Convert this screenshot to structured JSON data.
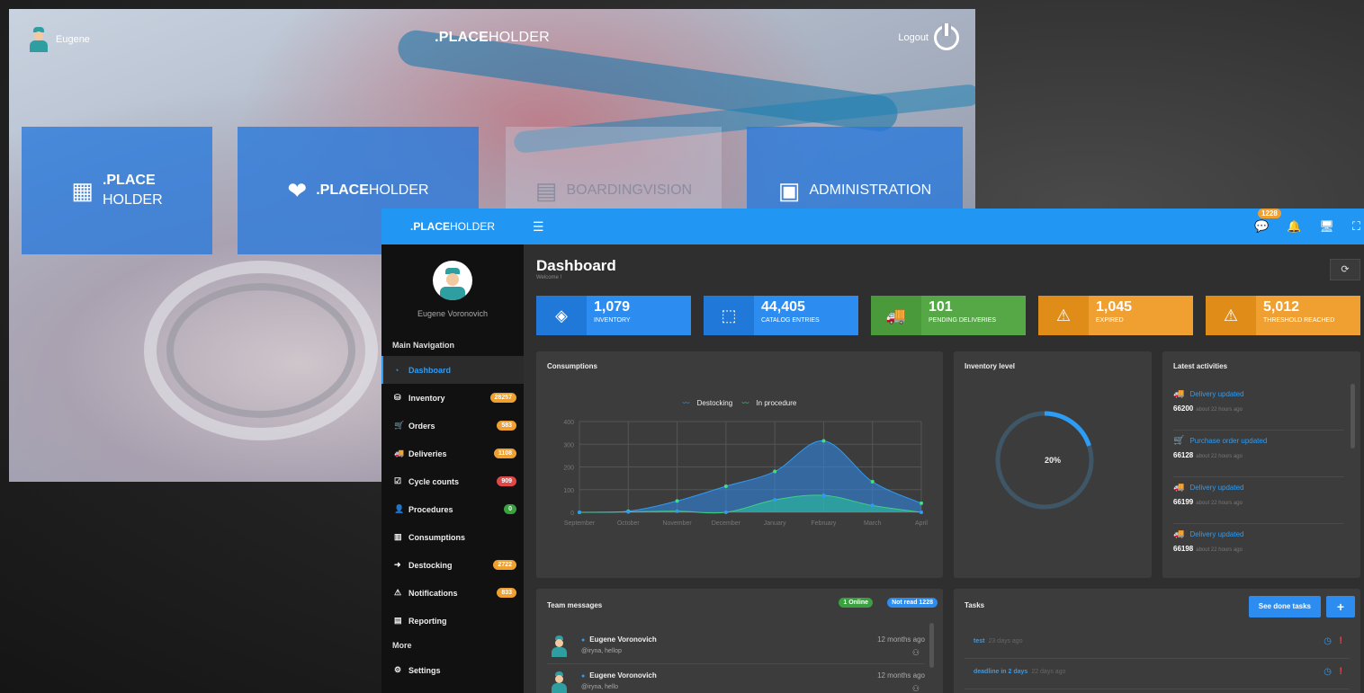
{
  "launcher": {
    "user_name": "Eugene",
    "title_bold": ".PLACE",
    "title_rest": "HOLDER",
    "logout_label": "Logout",
    "tiles": [
      {
        "bold": ".PLACE",
        "rest": "HOLDER",
        "icon": "warehouse-icon"
      },
      {
        "bold": ".PLACE",
        "rest": "HOLDER",
        "icon": "heart-icon"
      },
      {
        "bold": "",
        "rest": "BOARDINGVISION",
        "icon": "board-icon"
      },
      {
        "bold": "",
        "rest": "ADMINISTRATION",
        "icon": "admin-icon"
      }
    ]
  },
  "topbar": {
    "brand_bold": ".PLACE",
    "brand_rest": "HOLDER",
    "notification_count": "1228"
  },
  "sidebar": {
    "profile_name": "Eugene Voronovich",
    "main_label": "Main Navigation",
    "items": [
      {
        "label": "Dashboard",
        "icon": "dashboard-icon",
        "badge": "",
        "color": ""
      },
      {
        "label": "Inventory",
        "icon": "database-icon",
        "badge": "28257",
        "color": "orange"
      },
      {
        "label": "Orders",
        "icon": "cart-icon",
        "badge": "583",
        "color": "orange"
      },
      {
        "label": "Deliveries",
        "icon": "truck-icon",
        "badge": "1108",
        "color": "orange"
      },
      {
        "label": "Cycle counts",
        "icon": "checkbox-icon",
        "badge": "909",
        "color": "red"
      },
      {
        "label": "Procedures",
        "icon": "user-icon",
        "badge": "0",
        "color": "green"
      },
      {
        "label": "Consumptions",
        "icon": "bar-chart-icon",
        "badge": "",
        "color": ""
      },
      {
        "label": "Destocking",
        "icon": "sign-out-icon",
        "badge": "2722",
        "color": "orange"
      },
      {
        "label": "Notifications",
        "icon": "warning-icon",
        "badge": "833",
        "color": "orange"
      },
      {
        "label": "Reporting",
        "icon": "file-icon",
        "badge": "",
        "color": ""
      }
    ],
    "more_label": "More",
    "settings_label": "Settings"
  },
  "dashboard": {
    "title": "Dashboard",
    "subtitle": "Welcome !",
    "stats": [
      {
        "value": "1,079",
        "label": "INVENTORY",
        "icon": "layers-icon",
        "color": "blue"
      },
      {
        "value": "44,405",
        "label": "CATALOG ENTRIES",
        "icon": "box-icon",
        "color": "blue"
      },
      {
        "value": "101",
        "label": "PENDING DELIVERIES",
        "icon": "truck-icon",
        "color": "green"
      },
      {
        "value": "1,045",
        "label": "EXPIRED",
        "icon": "warning-icon",
        "color": "orange"
      },
      {
        "value": "5,012",
        "label": "THRESHOLD REACHED",
        "icon": "warning-icon",
        "color": "orange"
      }
    ]
  },
  "consumptions": {
    "title": "Consumptions"
  },
  "chart_data": {
    "type": "area",
    "title": "Consumptions",
    "categories": [
      "September",
      "October",
      "November",
      "December",
      "January",
      "February",
      "March",
      "April"
    ],
    "series": [
      {
        "name": "Destocking",
        "color": "#2d9cf5",
        "values": [
          0,
          5,
          50,
          115,
          180,
          315,
          135,
          40
        ]
      },
      {
        "name": "In procedure",
        "color": "#40d080",
        "values": [
          0,
          2,
          5,
          0,
          55,
          75,
          30,
          0
        ]
      }
    ],
    "yticks": [
      "400",
      "300",
      "200",
      "100",
      "0"
    ],
    "ylim": [
      0,
      400
    ],
    "grid": true,
    "legend": "top"
  },
  "inventory_level": {
    "title": "Inventory level",
    "percent": 20,
    "label": "20%"
  },
  "activities": {
    "title": "Latest activities",
    "items": [
      {
        "action": "Delivery updated",
        "icon": "truck-icon",
        "ref": "66200",
        "time": "about 22 hours ago"
      },
      {
        "action": "Purchase order updated",
        "icon": "cart-icon",
        "ref": "66128",
        "time": "about 22 hours ago"
      },
      {
        "action": "Delivery updated",
        "icon": "truck-icon",
        "ref": "66199",
        "time": "about 22 hours ago"
      },
      {
        "action": "Delivery updated",
        "icon": "truck-icon",
        "ref": "66198",
        "time": "about 22 hours ago"
      }
    ]
  },
  "team": {
    "title": "Team messages",
    "online_badge": "1 Online",
    "unread_badge": "Not read 1228",
    "messages": [
      {
        "name": "Eugene Voronovich",
        "text": "@iryna, hellop",
        "time": "12 months ago"
      },
      {
        "name": "Eugene Voronovich",
        "text": "@iryna, hello",
        "time": "12 months ago"
      }
    ]
  },
  "tasks": {
    "title": "Tasks",
    "done_label": "See done tasks",
    "add_label": "+",
    "items": [
      {
        "name": "test",
        "age": "23 days ago"
      },
      {
        "name": "deadline in 2 days",
        "age": "22 days ago"
      }
    ]
  }
}
